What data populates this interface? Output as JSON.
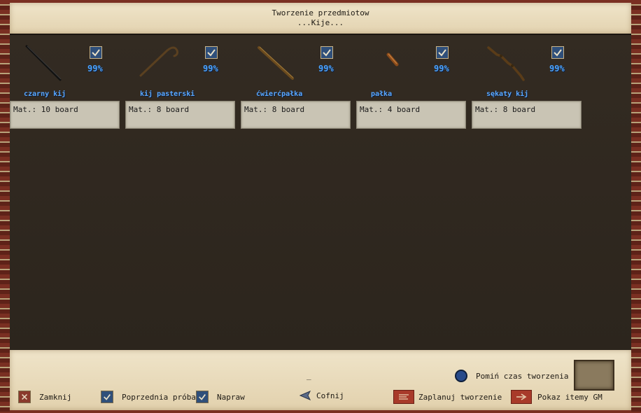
{
  "window": {
    "title": "Tworzenie przedmiotow",
    "subtitle": "...Kije..."
  },
  "items": [
    {
      "name": "czarny kij",
      "chance": "99%",
      "mat": "Mat.: 10 board",
      "checked": true,
      "icon": "black-staff-icon"
    },
    {
      "name": "kij pasterski",
      "chance": "99%",
      "mat": "Mat.: 8 board",
      "checked": true,
      "icon": "shepherds-crook-icon"
    },
    {
      "name": "ćwierćpałka",
      "chance": "99%",
      "mat": "Mat.: 8 board",
      "checked": true,
      "icon": "quarterstaff-icon"
    },
    {
      "name": "pałka",
      "chance": "99%",
      "mat": "Mat.: 4 board",
      "checked": true,
      "icon": "club-icon"
    },
    {
      "name": "sękaty kij",
      "chance": "99%",
      "mat": "Mat.: 8 board",
      "checked": true,
      "icon": "gnarled-staff-icon"
    }
  ],
  "footer": {
    "close": "Zamknij",
    "previous": "Poprzednia próba",
    "repair": "Napraw",
    "back": "Cofnij",
    "schedule": "Zaplanuj tworzenie",
    "show_gm": "Pokaz itemy GM",
    "skip_time": "Pomiń czas tworzenia",
    "dash": "_"
  },
  "colors": {
    "accent_blue": "#4aa3ff",
    "frame": "#6b2a1e",
    "parchment": "#efe4c9",
    "panel": "#2f281f"
  }
}
